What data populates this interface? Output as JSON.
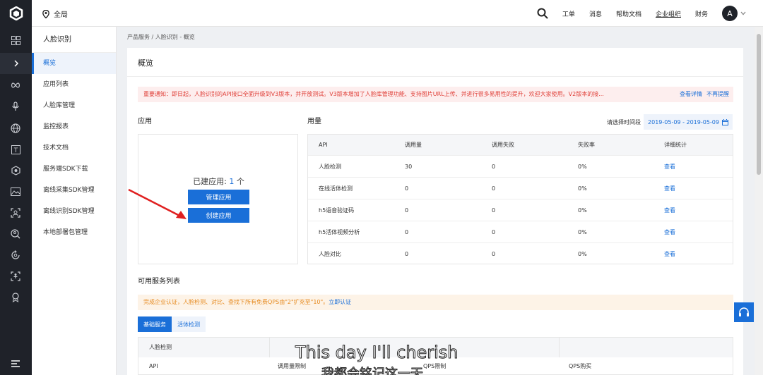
{
  "topbar": {
    "region": "全局",
    "links": [
      "工单",
      "消息",
      "帮助文档",
      "企业组织",
      "财务"
    ],
    "avatar_letter": "A"
  },
  "sidebar": {
    "title": "人脸识别",
    "items": [
      {
        "label": "概览",
        "active": true
      },
      {
        "label": "应用列表"
      },
      {
        "label": "人脸库管理"
      },
      {
        "label": "监控报表"
      },
      {
        "label": "技术文档"
      },
      {
        "label": "服务端SDK下载"
      },
      {
        "label": "离线采集SDK管理"
      },
      {
        "label": "离线识别SDK管理"
      },
      {
        "label": "本地部署包管理"
      }
    ]
  },
  "breadcrumb": "产品服务 / 人脸识别 - 概览",
  "main": {
    "title": "概览",
    "notice": "重要通知：即日起，人脸识别的API接口全面升级到V3版本，并开放测试。V3版本增加了人脸库管理功能、支持图片URL上传、并进行很多易用性的提升，欢迎大家使用。V2版本的接...",
    "notice_links": [
      "查看详情",
      "不再提醒"
    ],
    "app_section": "应用",
    "usage_section": "用量",
    "app_count_label": "已建应用:",
    "app_count": "1",
    "app_count_unit": "个",
    "manage_btn": "管理应用",
    "create_btn": "创建应用",
    "date_label": "请选择时间段",
    "date_range": "2019-05-09 - 2019-05-09",
    "usage_table": {
      "headers": [
        "API",
        "调用量",
        "调用失败",
        "失败率",
        "详细统计"
      ],
      "rows": [
        [
          "人脸检测",
          "30",
          "0",
          "0%",
          "查看"
        ],
        [
          "在线活体检测",
          "0",
          "0",
          "0%",
          "查看"
        ],
        [
          "h5语音验证码",
          "0",
          "0",
          "0%",
          "查看"
        ],
        [
          "h5活体视频分析",
          "0",
          "0",
          "0%",
          "查看"
        ],
        [
          "人脸对比",
          "0",
          "0",
          "0%",
          "查看"
        ]
      ]
    },
    "services_title": "可用服务列表",
    "promo": "完成企业认证，人脸检测、对比、查找下所有免费QPS由\"2\"扩充至\"10\"。",
    "promo_link": "立即认证",
    "tabs": [
      "基础服务",
      "活体检测"
    ],
    "svc_header": "人脸检测",
    "svc_cols": [
      "API",
      "调用量限制",
      "QPS限制",
      "QPS购买"
    ]
  },
  "subtitle": {
    "line1": "This day I'll cherish",
    "line2": "我都会铭记这一天"
  },
  "colors": {
    "accent": "#1a6fd8",
    "rail": "#1f2229",
    "notice_text": "#e0413a",
    "promo_text": "#e68a1f",
    "arrow": "#e02020"
  }
}
